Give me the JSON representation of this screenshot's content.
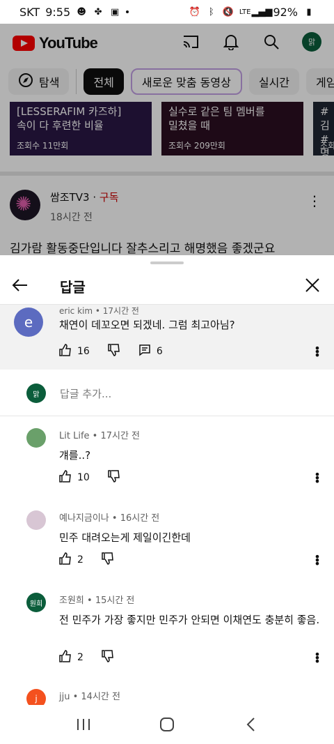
{
  "status_bar": {
    "carrier": "SKT",
    "time": "9:55",
    "battery": "92%",
    "network": "LTE"
  },
  "youtube": {
    "logo_text": "YouTube",
    "avatar_text": "맑",
    "chips": [
      "탐색",
      "전체",
      "새로운 맞춤 동영상",
      "실시간",
      "게임"
    ],
    "videos": [
      {
        "title_line1": "[LESSERAFIM 카즈하]",
        "title_line2": "속이 다 후련한 비율",
        "views": "조회수 11만회"
      },
      {
        "title_line1": "실수로 같은 팀 멤버를",
        "title_line2": "밀쳤을 때",
        "views": "조회수 209만회"
      },
      {
        "title_line1": "#김",
        "title_line2": "#명",
        "views": "조회"
      }
    ],
    "post": {
      "channel": "쌈조TV3",
      "subscribe": "구독",
      "time": "18시간 전",
      "text": "김가람 활동중단입니다 잘추스리고 해명했음 좋겠군요"
    }
  },
  "sheet": {
    "title": "답글",
    "parent": {
      "avatar": "e",
      "author": "eric kim",
      "time": "17시간 전",
      "text": "채연이 데꼬오면 되겠네. 그럼 최고아님?",
      "likes": "16",
      "replies": "6"
    },
    "add_reply": {
      "avatar": "맑",
      "placeholder": "답글 추가..."
    },
    "replies": [
      {
        "author": "Lit Life",
        "time": "17시간 전",
        "text": "걔를..?",
        "likes": "10",
        "avatar_color": "#6aa06a",
        "avatar": ""
      },
      {
        "author": "예나지금이나",
        "time": "16시간 전",
        "text": "민주 대려오는게 제일이긴한데",
        "likes": "2",
        "avatar_color": "#d8c6d4",
        "avatar": ""
      },
      {
        "author": "조원희",
        "time": "15시간 전",
        "text": "전 민주가 가장 좋지만 민주가 안되면 이채연도 충분히 좋음.",
        "likes": "2",
        "avatar_color": "#0b5d3b",
        "avatar": "원희"
      },
      {
        "author": "jju",
        "time": "14시간 전",
        "text": "",
        "likes": "",
        "avatar_color": "#f4511e",
        "avatar": "j"
      }
    ],
    "meta_separator": " • "
  }
}
